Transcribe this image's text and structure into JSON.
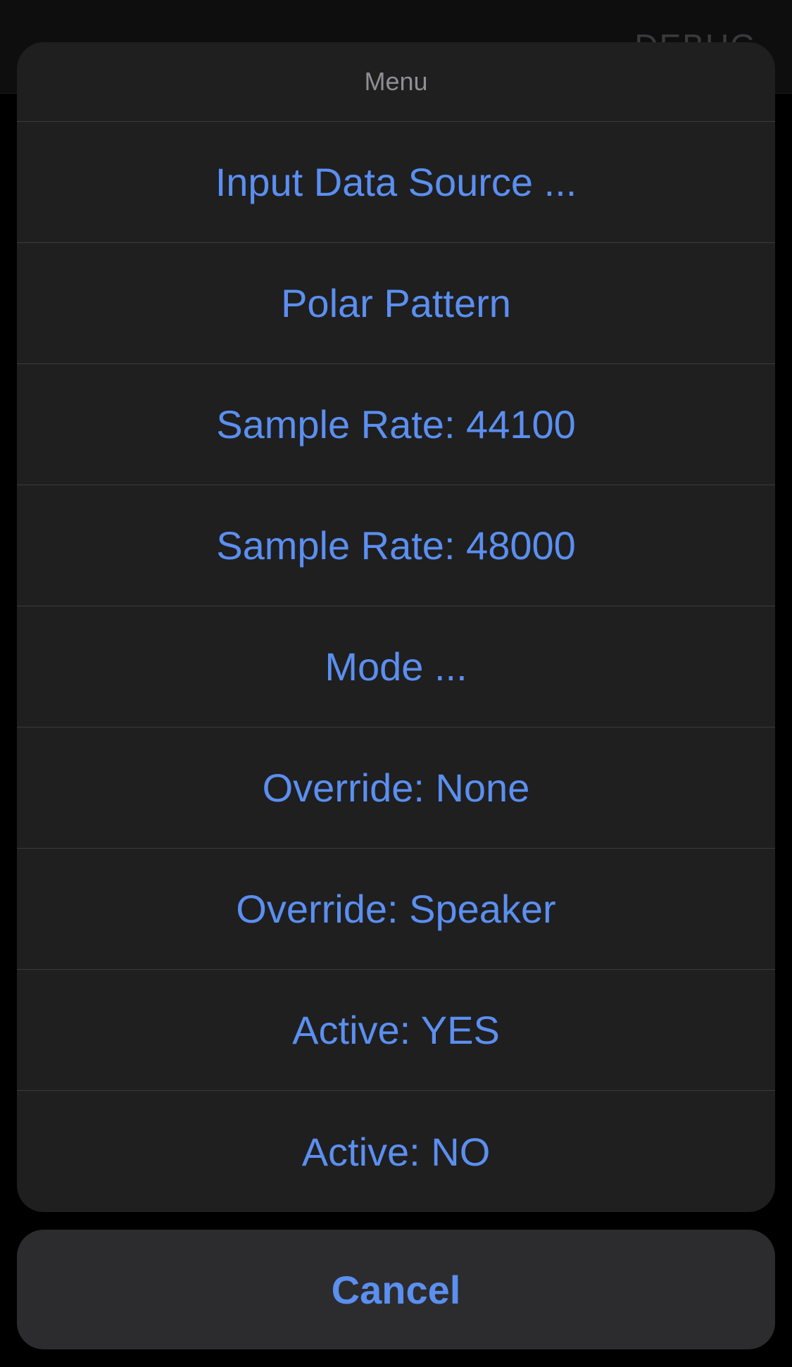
{
  "nav": {
    "right_label": "DEBUG"
  },
  "action_sheet": {
    "title": "Menu",
    "items": [
      {
        "label": "Input Data Source ..."
      },
      {
        "label": "Polar Pattern"
      },
      {
        "label": "Sample Rate: 44100"
      },
      {
        "label": "Sample Rate: 48000"
      },
      {
        "label": "Mode ..."
      },
      {
        "label": "Override: None"
      },
      {
        "label": "Override: Speaker"
      },
      {
        "label": "Active: YES"
      },
      {
        "label": "Active: NO"
      }
    ],
    "cancel_label": "Cancel"
  },
  "colors": {
    "accent": "#5b8ff0",
    "sheet_background": "#1f1f20",
    "cancel_background": "#2c2c2e",
    "separator": "#3b3b3e",
    "title_text": "#8e8e93"
  }
}
